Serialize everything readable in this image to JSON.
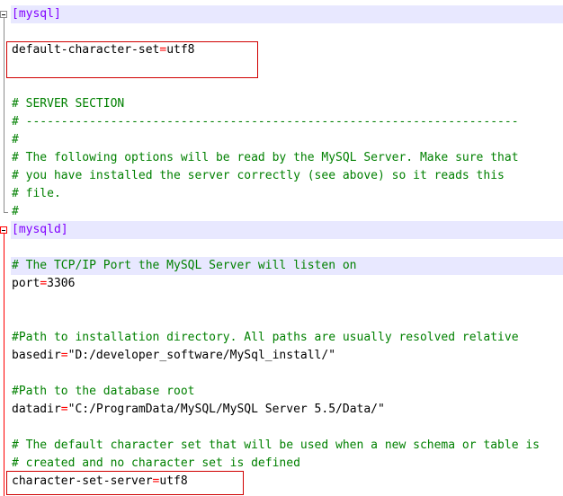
{
  "editor": {
    "lines": [
      {
        "type": "section",
        "text": "[mysql]",
        "hl": true
      },
      {
        "type": "blank",
        "text": ""
      },
      {
        "type": "kv",
        "key": "default-character-set",
        "op": "=",
        "value": "utf8"
      },
      {
        "type": "blank",
        "text": ""
      },
      {
        "type": "blank",
        "text": ""
      },
      {
        "type": "comment",
        "text": "# SERVER SECTION"
      },
      {
        "type": "comment",
        "text": "# ----------------------------------------------------------------------"
      },
      {
        "type": "comment",
        "text": "#"
      },
      {
        "type": "comment",
        "text": "# The following options will be read by the MySQL Server. Make sure that"
      },
      {
        "type": "comment",
        "text": "# you have installed the server correctly (see above) so it reads this"
      },
      {
        "type": "comment",
        "text": "# file."
      },
      {
        "type": "comment",
        "text": "#"
      },
      {
        "type": "section",
        "text": "[mysqld]",
        "hl": true
      },
      {
        "type": "blank",
        "text": ""
      },
      {
        "type": "comment",
        "text": "# The TCP/IP Port the MySQL Server will listen on",
        "hl": true
      },
      {
        "type": "kv",
        "key": "port",
        "op": "=",
        "value": "3306"
      },
      {
        "type": "blank",
        "text": ""
      },
      {
        "type": "blank",
        "text": ""
      },
      {
        "type": "comment",
        "text": "#Path to installation directory. All paths are usually resolved relative"
      },
      {
        "type": "kv",
        "key": "basedir",
        "op": "=",
        "value": "\"D:/developer_software/MySql_install/\""
      },
      {
        "type": "blank",
        "text": ""
      },
      {
        "type": "comment",
        "text": "#Path to the database root"
      },
      {
        "type": "kv",
        "key": "datadir",
        "op": "=",
        "value": "\"C:/ProgramData/MySQL/MySQL Server 5.5/Data/\""
      },
      {
        "type": "blank",
        "text": ""
      },
      {
        "type": "comment",
        "text": "# The default character set that will be used when a new schema or table is"
      },
      {
        "type": "comment",
        "text": "# created and no character set is defined"
      },
      {
        "type": "kv",
        "key": "character-set-server",
        "op": "=",
        "value": "utf8"
      }
    ]
  }
}
